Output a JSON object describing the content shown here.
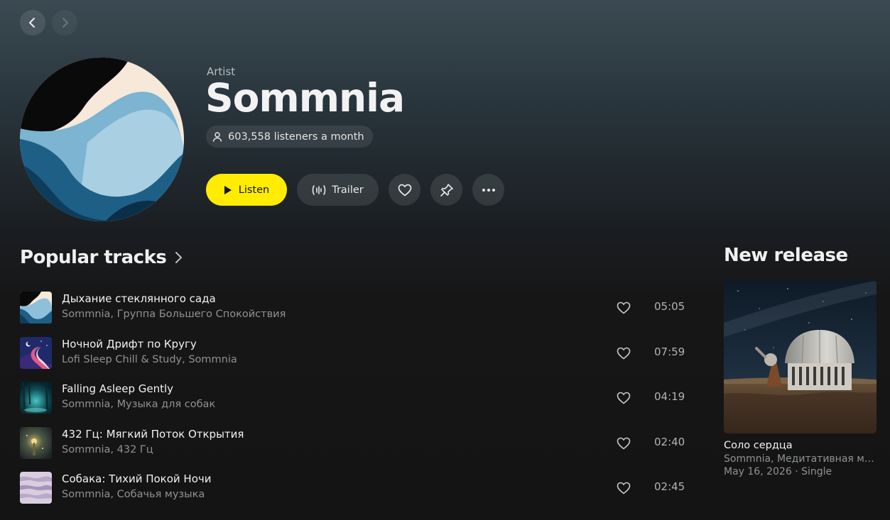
{
  "nav": {
    "back_icon": "chevron-left-icon",
    "forward_icon": "chevron-right-icon"
  },
  "artist": {
    "type_label": "Artist",
    "name": "Sommnia",
    "listeners": "603,558 listeners a month"
  },
  "actions": {
    "listen_label": "Listen",
    "trailer_label": "Trailer",
    "like_icon": "heart-icon",
    "pin_icon": "pin-icon",
    "more_icon": "more-icon"
  },
  "popular": {
    "title": "Popular tracks",
    "tracks": [
      {
        "title": "Дыхание стеклянного сада",
        "artists": "Sommnia, Группа Большего Спокойствия",
        "duration": "05:05"
      },
      {
        "title": "Ночной Дрифт по Кругу",
        "artists": "Lofi Sleep Chill & Study, Sommnia",
        "duration": "07:59"
      },
      {
        "title": "Falling Asleep Gently",
        "artists": "Sommnia, Музыка для собак",
        "duration": "04:19"
      },
      {
        "title": "432 Гц: Мягкий Поток Открытия",
        "artists": "Sommnia, 432 Гц",
        "duration": "02:40"
      },
      {
        "title": "Собака: Тихий Покой Ночи",
        "artists": "Sommnia, Собачья музыка",
        "duration": "02:45"
      }
    ]
  },
  "new_release": {
    "title": "New release",
    "album_title": "Соло сердца",
    "artists": "Sommnia, Медитативная музыка",
    "meta": "May 16, 2026 · Single"
  },
  "colors": {
    "accent": "#ffec00",
    "muted_text": "#8e9296"
  }
}
